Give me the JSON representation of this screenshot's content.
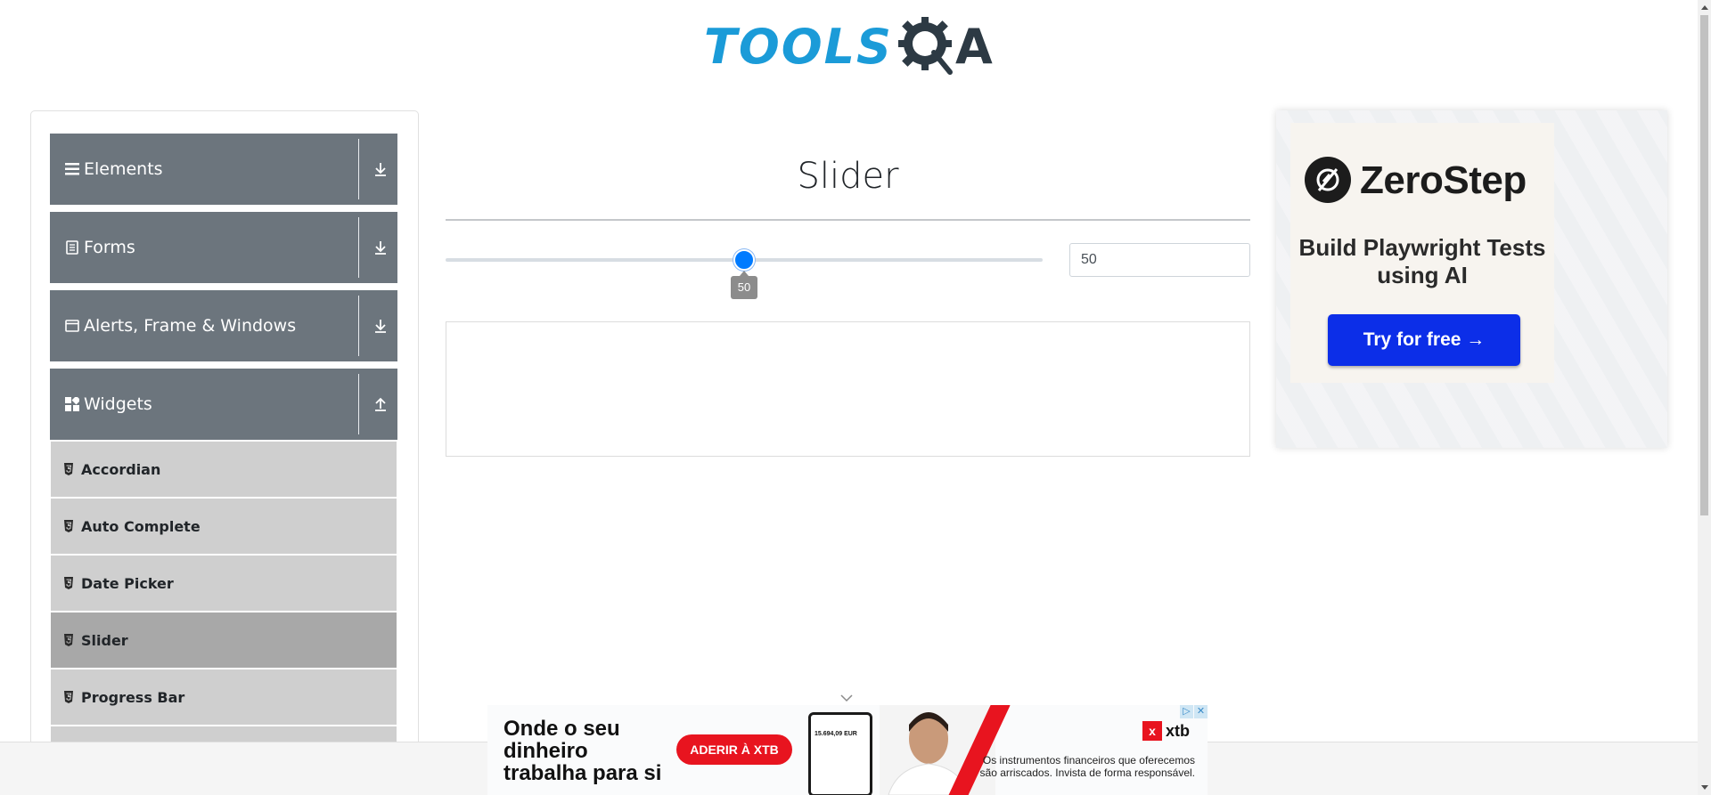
{
  "header": {
    "logo_tools": "TOOLS",
    "logo_a": "A"
  },
  "sidebar": {
    "groups": [
      {
        "label": "Elements",
        "icon": "list-icon",
        "arrow": "download-arrow-icon"
      },
      {
        "label": "Forms",
        "icon": "document-icon",
        "arrow": "download-arrow-icon"
      },
      {
        "label": "Alerts, Frame & Windows",
        "icon": "window-icon",
        "arrow": "download-arrow-icon"
      },
      {
        "label": "Widgets",
        "icon": "widgets-icon",
        "arrow": "upload-arrow-icon"
      }
    ],
    "items": [
      {
        "label": "Accordian",
        "icon": "html5-icon"
      },
      {
        "label": "Auto Complete",
        "icon": "html5-icon"
      },
      {
        "label": "Date Picker",
        "icon": "html5-icon"
      },
      {
        "label": "Slider",
        "icon": "html5-icon",
        "active": true
      },
      {
        "label": "Progress Bar",
        "icon": "html5-icon"
      }
    ]
  },
  "main": {
    "title": "Slider",
    "slider": {
      "min": 0,
      "max": 100,
      "value": 50,
      "tooltip": "50",
      "value_field": "50"
    }
  },
  "ad_right": {
    "brand": "ZeroStep",
    "tagline": "Build Playwright Tests using AI",
    "button": "Try for free →"
  },
  "ad_bottom": {
    "headline_1": "Onde o seu",
    "headline_2": "dinheiro",
    "headline_3": "trabalha para si",
    "button": "ADERIR À XTB",
    "phone_amount": "15.694,09 EUR",
    "brand": "xtb",
    "brand_mark": "x",
    "disclaimer_1": "Os instrumentos financeiros que oferecemos",
    "disclaimer_2": "são arriscados. Invista de forma responsável.",
    "adchoices": "▷",
    "close": "✕"
  },
  "colors": {
    "accent": "#007bff",
    "sidebar_header": "#6c757d",
    "sidebar_item": "#cfcfcf",
    "sidebar_item_active": "#a8a8a8",
    "logo_blue": "#1b9bd8",
    "zerostep_button": "#0c2ee8",
    "xtb_red": "#e8141f"
  }
}
